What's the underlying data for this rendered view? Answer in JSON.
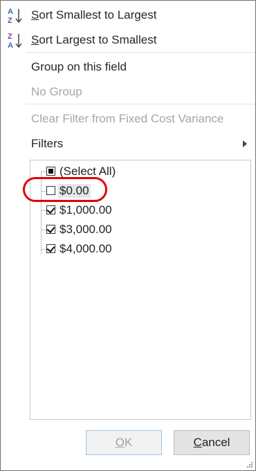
{
  "menu": {
    "sort_asc": {
      "prefix": "S",
      "rest": "ort Smallest to Largest",
      "icon": "sort-ascending-icon"
    },
    "sort_desc": {
      "prefix": "S",
      "rest": "ort Largest to Smallest",
      "icon": "sort-descending-icon"
    },
    "group": "Group on this field",
    "no_group": "No Group",
    "clear_filter": "Clear Filter from Fixed Cost Variance",
    "filters": "Filters"
  },
  "filter_list": {
    "items": [
      {
        "label": "(Select All)",
        "state": "partial"
      },
      {
        "label": "$0.00",
        "state": "unchecked"
      },
      {
        "label": "$1,000.00",
        "state": "checked"
      },
      {
        "label": "$3,000.00",
        "state": "checked"
      },
      {
        "label": "$4,000.00",
        "state": "checked"
      }
    ]
  },
  "buttons": {
    "ok": {
      "accel": "O",
      "rest": "K"
    },
    "cancel": {
      "accel": "C",
      "rest": "ancel"
    }
  },
  "colors": {
    "highlight": "#e00000",
    "sort_icon_blue": "#2e6fc0",
    "sort_icon_purple": "#7b3fa0"
  }
}
